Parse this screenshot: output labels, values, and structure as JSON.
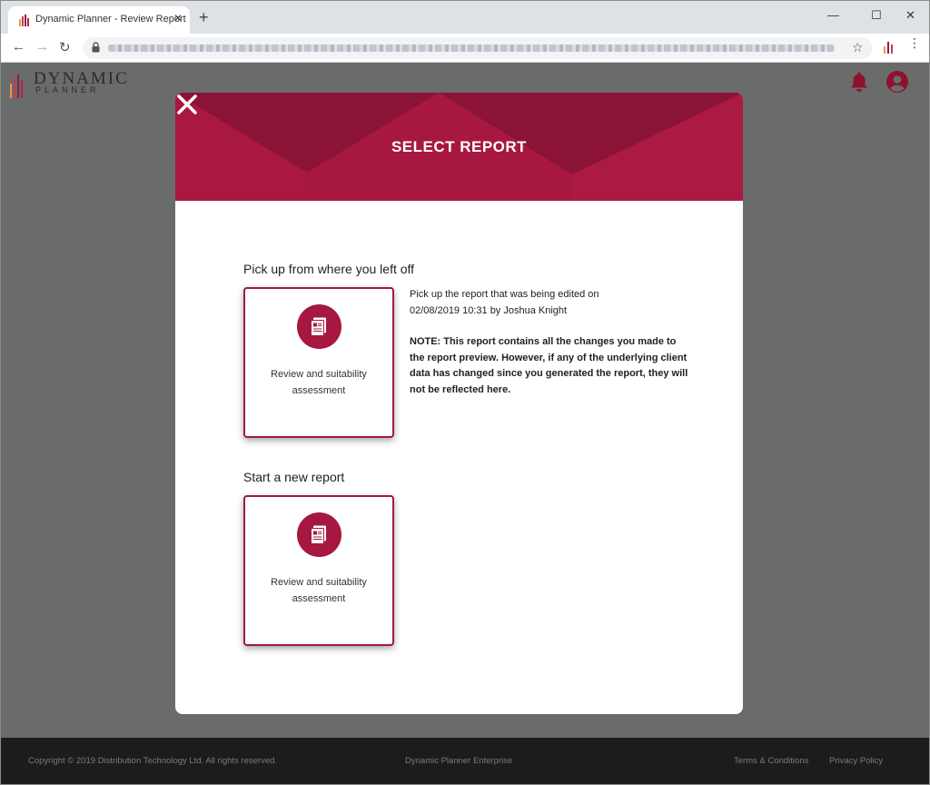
{
  "browser": {
    "tab_title": "Dynamic Planner - Review Report",
    "tab_close": "✕",
    "new_tab": "+",
    "minimize": "—",
    "maximize": "☐",
    "close_window": "✕",
    "back": "←",
    "forward": "→",
    "reload": "↻",
    "bookmark": "☆",
    "menu": "⋮"
  },
  "logo": {
    "line1": "DYNAMIC",
    "line2": "PLANNER"
  },
  "modal": {
    "title": "SELECT REPORT",
    "resume_section": {
      "heading": "Pick up from where you left off",
      "card_label": "Review and suitability assessment",
      "info_line1": "Pick up the report that was being edited on",
      "info_line2": "02/08/2019 10:31 by Joshua Knight",
      "note": "NOTE: This report contains all the changes you made to the report preview. However, if any of the underlying client data has changed since you generated the report, they will not be reflected here."
    },
    "new_section": {
      "heading": "Start a new report",
      "card_label": "Review and suitability assessment"
    }
  },
  "footer": {
    "copyright": "Copyright © 2019 Distribution Technology Ltd. All rights reserved.",
    "product": "Dynamic Planner Enterprise",
    "terms": "Terms & Conditions",
    "privacy": "Privacy Policy"
  },
  "colors": {
    "brand": "#a6183f",
    "backdrop": "#6a6b6b",
    "footer": "#1c1c1c"
  },
  "icons": [
    "logo-bars-icon",
    "lock-icon",
    "star-icon",
    "bell-icon",
    "avatar-icon",
    "close-icon",
    "report-icon"
  ]
}
